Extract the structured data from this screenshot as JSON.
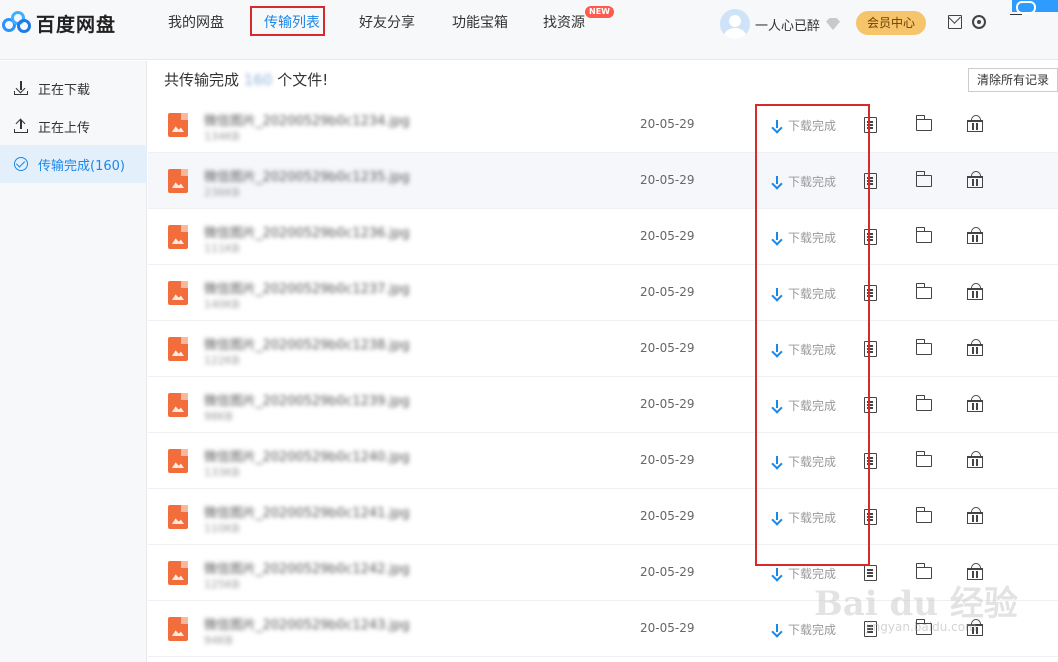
{
  "app": {
    "name": "百度网盘"
  },
  "nav": {
    "items": [
      {
        "label": "我的网盘"
      },
      {
        "label": "传输列表"
      },
      {
        "label": "好友分享"
      },
      {
        "label": "功能宝箱"
      },
      {
        "label": "找资源",
        "badge": "NEW"
      }
    ]
  },
  "user": {
    "name": "一人心已醉",
    "vip_label": "会员中心"
  },
  "sidebar": {
    "items": [
      {
        "label": "正在下载"
      },
      {
        "label": "正在上传"
      },
      {
        "label": "传输完成(160)"
      }
    ]
  },
  "main": {
    "summary_prefix": "共传输完成",
    "summary_blurred": "160",
    "summary_suffix": "个文件!",
    "clear_label": "清除所有记录"
  },
  "files": [
    {
      "name": "微信图片_20200529b0c1234.jpg",
      "size": "134KB",
      "date": "20-05-29",
      "status": "下载完成"
    },
    {
      "name": "微信图片_20200529b0c1235.jpg",
      "size": "236KB",
      "date": "20-05-29",
      "status": "下载完成"
    },
    {
      "name": "微信图片_20200529b0c1236.jpg",
      "size": "111KB",
      "date": "20-05-29",
      "status": "下载完成"
    },
    {
      "name": "微信图片_20200529b0c1237.jpg",
      "size": "140KB",
      "date": "20-05-29",
      "status": "下载完成"
    },
    {
      "name": "微信图片_20200529b0c1238.jpg",
      "size": "122KB",
      "date": "20-05-29",
      "status": "下载完成"
    },
    {
      "name": "微信图片_20200529b0c1239.jpg",
      "size": "98KB",
      "date": "20-05-29",
      "status": "下载完成"
    },
    {
      "name": "微信图片_20200529b0c1240.jpg",
      "size": "133KB",
      "date": "20-05-29",
      "status": "下载完成"
    },
    {
      "name": "微信图片_20200529b0c1241.jpg",
      "size": "110KB",
      "date": "20-05-29",
      "status": "下载完成"
    },
    {
      "name": "微信图片_20200529b0c1242.jpg",
      "size": "125KB",
      "date": "20-05-29",
      "status": "下载完成"
    },
    {
      "name": "微信图片_20200529b0c1243.jpg",
      "size": "94KB",
      "date": "20-05-29",
      "status": "下载完成"
    }
  ],
  "watermark": {
    "text": "Bai du 经验",
    "url": "jingyan.baidu.com"
  }
}
